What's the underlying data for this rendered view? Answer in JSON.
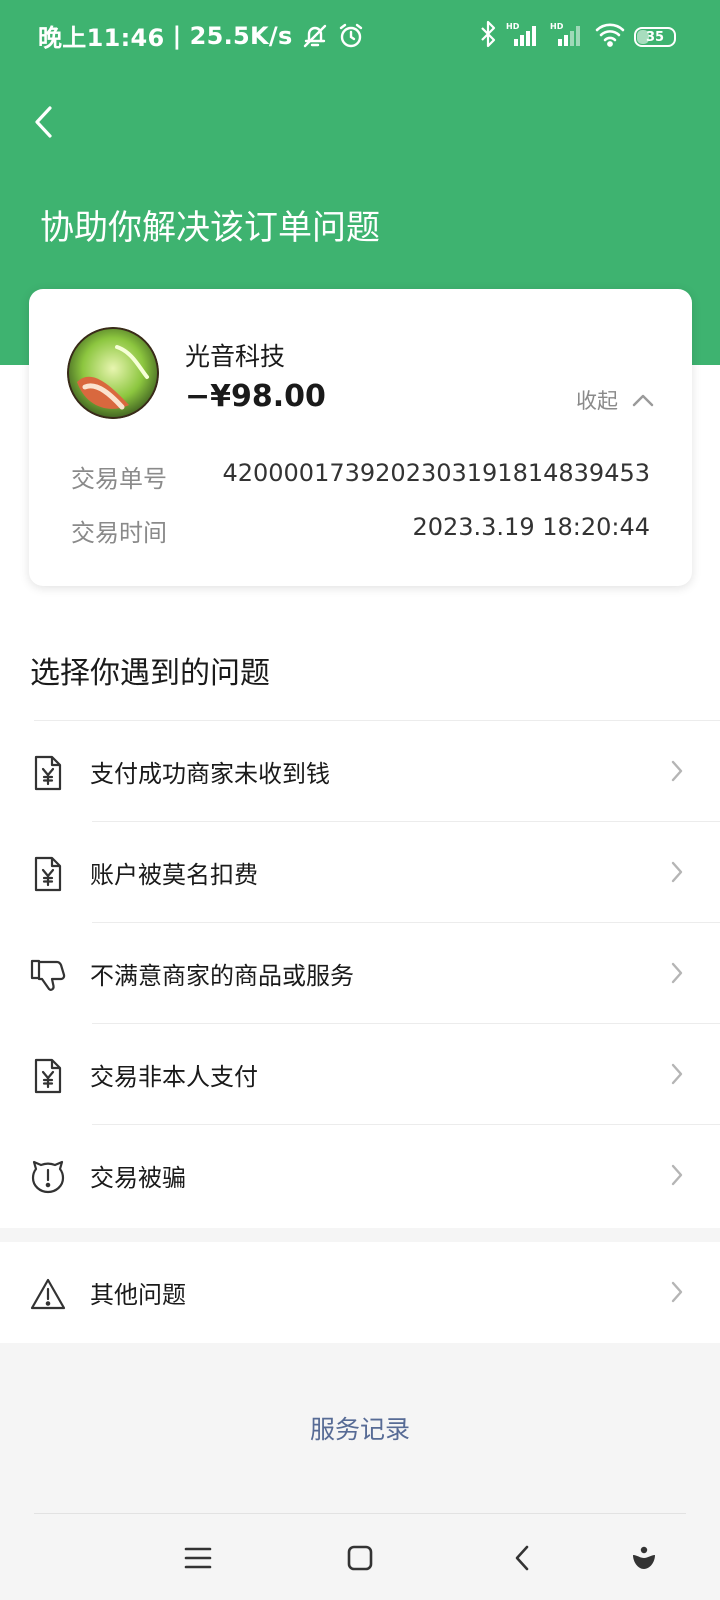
{
  "status_bar": {
    "time": "晚上11:46",
    "separator": "|",
    "speed": "25.5K/s",
    "battery": "35"
  },
  "header": {
    "title": "协助你解决该订单问题"
  },
  "order_card": {
    "merchant": "光音科技",
    "amount": "−¥98.00",
    "collapse_label": "收起",
    "rows": [
      {
        "label": "交易单号",
        "value": "4200001739202303191814839453"
      },
      {
        "label": "交易时间",
        "value": "2023.3.19 18:20:44"
      }
    ]
  },
  "problems": {
    "title": "选择你遇到的问题",
    "items": [
      {
        "label": "支付成功商家未收到钱",
        "icon": "receipt-yen-icon"
      },
      {
        "label": "账户被莫名扣费",
        "icon": "receipt-yen-icon"
      },
      {
        "label": "不满意商家的商品或服务",
        "icon": "thumbs-down-icon"
      },
      {
        "label": "交易非本人支付",
        "icon": "receipt-yen-icon"
      },
      {
        "label": "交易被骗",
        "icon": "alert-face-icon"
      }
    ],
    "other": {
      "label": "其他问题",
      "icon": "warning-triangle-icon"
    }
  },
  "footer": {
    "service_record": "服务记录"
  },
  "colors": {
    "header_green": "#3eb370",
    "link_blue": "#576b95"
  }
}
